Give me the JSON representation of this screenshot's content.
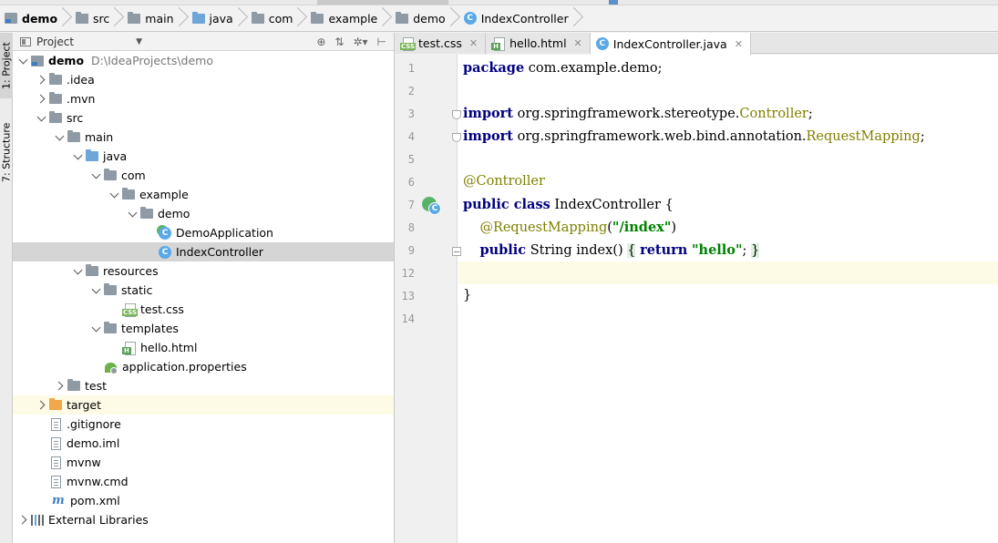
{
  "breadcrumbs": [
    {
      "label": "demo",
      "icon": "module-folder-icon",
      "bold": true
    },
    {
      "label": "src",
      "icon": "folder-icon"
    },
    {
      "label": "main",
      "icon": "folder-icon"
    },
    {
      "label": "java",
      "icon": "source-folder-icon"
    },
    {
      "label": "com",
      "icon": "package-icon"
    },
    {
      "label": "example",
      "icon": "package-icon"
    },
    {
      "label": "demo",
      "icon": "package-icon"
    },
    {
      "label": "IndexController",
      "icon": "class-icon"
    }
  ],
  "side_tabs": {
    "project": "1: Project",
    "structure": "7: Structure"
  },
  "project_panel": {
    "title": "Project",
    "tree": [
      {
        "label": "demo",
        "path": "D:\\IdeaProjects\\demo",
        "depth": 0,
        "arrow": "open",
        "icon": "module",
        "bold": true
      },
      {
        "label": ".idea",
        "depth": 1,
        "arrow": "closed",
        "icon": "folder"
      },
      {
        "label": ".mvn",
        "depth": 1,
        "arrow": "closed",
        "icon": "folder"
      },
      {
        "label": "src",
        "depth": 1,
        "arrow": "open",
        "icon": "folder"
      },
      {
        "label": "main",
        "depth": 2,
        "arrow": "open",
        "icon": "folder"
      },
      {
        "label": "java",
        "depth": 3,
        "arrow": "open",
        "icon": "source-folder"
      },
      {
        "label": "com",
        "depth": 4,
        "arrow": "open",
        "icon": "folder"
      },
      {
        "label": "example",
        "depth": 5,
        "arrow": "open",
        "icon": "folder"
      },
      {
        "label": "demo",
        "depth": 6,
        "arrow": "open",
        "icon": "folder"
      },
      {
        "label": "DemoApplication",
        "depth": 7,
        "arrow": "none",
        "icon": "class-run"
      },
      {
        "label": "IndexController",
        "depth": 7,
        "arrow": "none",
        "icon": "class",
        "selected": true
      },
      {
        "label": "resources",
        "depth": 3,
        "arrow": "open",
        "icon": "resources-folder"
      },
      {
        "label": "static",
        "depth": 4,
        "arrow": "open",
        "icon": "folder"
      },
      {
        "label": "test.css",
        "depth": 5,
        "arrow": "none",
        "icon": "css"
      },
      {
        "label": "templates",
        "depth": 4,
        "arrow": "open",
        "icon": "folder"
      },
      {
        "label": "hello.html",
        "depth": 5,
        "arrow": "none",
        "icon": "html"
      },
      {
        "label": "application.properties",
        "depth": 4,
        "arrow": "none",
        "icon": "properties"
      },
      {
        "label": "test",
        "depth": 2,
        "arrow": "closed",
        "icon": "folder"
      },
      {
        "label": "target",
        "depth": 1,
        "arrow": "closed",
        "icon": "excluded-folder",
        "highlight": true
      },
      {
        "label": ".gitignore",
        "depth": 1,
        "arrow": "none",
        "icon": "text-file"
      },
      {
        "label": "demo.iml",
        "depth": 1,
        "arrow": "none",
        "icon": "text-file"
      },
      {
        "label": "mvnw",
        "depth": 1,
        "arrow": "none",
        "icon": "text-file"
      },
      {
        "label": "mvnw.cmd",
        "depth": 1,
        "arrow": "none",
        "icon": "text-file"
      },
      {
        "label": "pom.xml",
        "depth": 1,
        "arrow": "none",
        "icon": "maven"
      },
      {
        "label": "External Libraries",
        "depth": 0,
        "arrow": "closed",
        "icon": "libraries"
      }
    ]
  },
  "editor_tabs": [
    {
      "label": "test.css",
      "icon": "css",
      "active": false
    },
    {
      "label": "hello.html",
      "icon": "html",
      "active": false
    },
    {
      "label": "IndexController.java",
      "icon": "class",
      "active": true
    }
  ],
  "editor": {
    "current_line": 12,
    "lines": [
      {
        "n": "1",
        "tokens": [
          {
            "t": "package",
            "c": "kw"
          },
          {
            "t": " com.example.demo;",
            "c": "pkg"
          }
        ]
      },
      {
        "n": "2",
        "tokens": []
      },
      {
        "n": "3",
        "fold": "start",
        "tokens": [
          {
            "t": "import",
            "c": "kw"
          },
          {
            "t": " org.springframework.stereotype.",
            "c": "pkg"
          },
          {
            "t": "Controller",
            "c": "ann"
          },
          {
            "t": ";",
            "c": "pkg"
          }
        ]
      },
      {
        "n": "4",
        "fold": "start",
        "tokens": [
          {
            "t": "import",
            "c": "kw"
          },
          {
            "t": " org.springframework.web.bind.annotation.",
            "c": "pkg"
          },
          {
            "t": "RequestMapping",
            "c": "ann"
          },
          {
            "t": ";",
            "c": "pkg"
          }
        ]
      },
      {
        "n": "5",
        "tokens": []
      },
      {
        "n": "6",
        "tokens": [
          {
            "t": "@Controller",
            "c": "ann"
          }
        ]
      },
      {
        "n": "7",
        "bean": true,
        "tokens": [
          {
            "t": "public class",
            "c": "kw"
          },
          {
            "t": " IndexController {",
            "c": "pkg"
          }
        ]
      },
      {
        "n": "8",
        "tokens": [
          {
            "t": "    ",
            "c": "pkg"
          },
          {
            "t": "@RequestMapping",
            "c": "ann"
          },
          {
            "t": "(",
            "c": "pkg"
          },
          {
            "t": "\"/index\"",
            "c": "str"
          },
          {
            "t": ")",
            "c": "pkg"
          }
        ]
      },
      {
        "n": "9",
        "fold": "box",
        "tokens": [
          {
            "t": "    ",
            "c": "pkg"
          },
          {
            "t": "public",
            "c": "kw"
          },
          {
            "t": " String index() ",
            "c": "pkg"
          },
          {
            "t": "{",
            "c": "brace-hl"
          },
          {
            "t": " ",
            "c": "pkg"
          },
          {
            "t": "return",
            "c": "kw"
          },
          {
            "t": " ",
            "c": "pkg"
          },
          {
            "t": "\"hello\"",
            "c": "str"
          },
          {
            "t": "; ",
            "c": "pkg"
          },
          {
            "t": "}",
            "c": "brace-hl"
          }
        ]
      },
      {
        "n": "12",
        "tokens": []
      },
      {
        "n": "13",
        "tokens": [
          {
            "t": "}",
            "c": "pkg"
          }
        ]
      },
      {
        "n": "14",
        "tokens": []
      }
    ]
  }
}
